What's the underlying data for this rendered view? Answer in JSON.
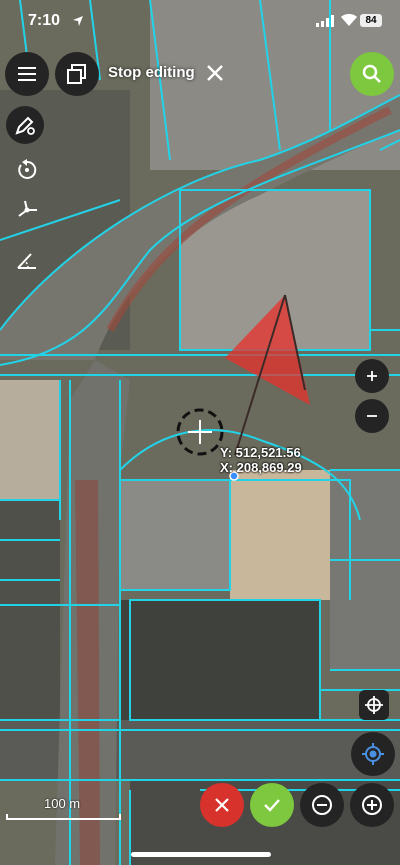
{
  "status_bar": {
    "time": "7:10",
    "battery": "84"
  },
  "toolbar": {
    "stop_editing_label": "Stop editing"
  },
  "map": {
    "coordinates": {
      "y": "Y: 512,521.56",
      "x": "X: 208,869.29"
    },
    "scale_label": "100 m",
    "parcel_line_color": "#22d3e8",
    "direction_cone_color": "#e8302b"
  },
  "colors": {
    "search_button": "#7dc83e",
    "cancel_button": "#d7322c",
    "confirm_button": "#7dc83e",
    "button_dark": "#242424"
  },
  "icons": [
    "menu-icon",
    "layers-icon",
    "close-icon",
    "search-icon",
    "pen-settings-icon",
    "rotate-icon",
    "vertex-icon",
    "angle-icon",
    "zoom-in-icon",
    "zoom-out-icon",
    "target-icon",
    "gps-locate-icon",
    "cancel-icon",
    "check-icon",
    "minus-circle-icon",
    "plus-circle-icon",
    "crosshair-icon"
  ]
}
